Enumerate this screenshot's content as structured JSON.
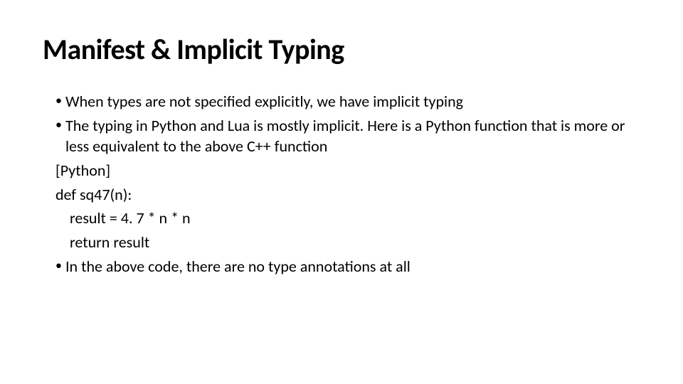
{
  "title": "Manifest & Implicit Typing",
  "body": {
    "bullet1": "When types are not specified explicitly, we have implicit typing",
    "bullet2": "The typing in Python and Lua is mostly implicit. Here is a Python function that is more or less equivalent to the above C++ function",
    "line_lang": "[Python]",
    "line_def": "def sq47(n):",
    "line_assign": "result = 4. 7 * n * n",
    "line_return": "return result",
    "bullet3": "In the above code, there are no type annotations at all"
  }
}
